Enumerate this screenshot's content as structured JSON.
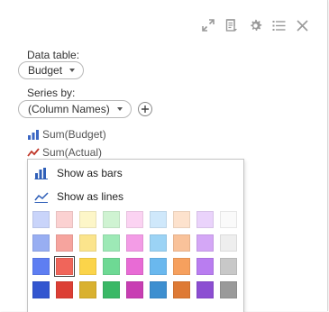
{
  "toolbar": {
    "icons": [
      "expand-icon",
      "data-icon",
      "gear-icon",
      "list-icon",
      "close-icon"
    ]
  },
  "data_table": {
    "label": "Data table:",
    "value": "Budget"
  },
  "series_by": {
    "label": "Series by:",
    "value": "(Column Names)"
  },
  "series": [
    {
      "label": "Sum(Budget)",
      "icon": "bar-chart-icon",
      "color": "#3b66c4"
    },
    {
      "label": "Sum(Actual)",
      "icon": "line-chart-icon",
      "color": "#c0392b"
    }
  ],
  "menu": {
    "show_as_bars": "Show as bars",
    "show_as_lines": "Show as lines"
  },
  "palette": {
    "selected": [
      2,
      1
    ],
    "rows": [
      [
        "#c9d4fa",
        "#fbd1d1",
        "#fdf6c8",
        "#cff3d2",
        "#fbd3f2",
        "#cfe8fb",
        "#fde2cd",
        "#ead3fb",
        "#fafafa"
      ],
      [
        "#98aef2",
        "#f6a49e",
        "#fbe48c",
        "#9de9b6",
        "#f39ce6",
        "#9bd3f5",
        "#f9c29a",
        "#d4a7f6",
        "#eeeeee"
      ],
      [
        "#5e7ef2",
        "#f0655a",
        "#fbd44a",
        "#6ed994",
        "#e86bd5",
        "#6ab8ee",
        "#f6a05e",
        "#b97df0",
        "#c8c8c8"
      ],
      [
        "#3356d0",
        "#dc3f35",
        "#d9b12f",
        "#3ab866",
        "#c83eb3",
        "#3d8fd0",
        "#de7a35",
        "#8c4ed2",
        "#9a9a9a"
      ]
    ]
  }
}
